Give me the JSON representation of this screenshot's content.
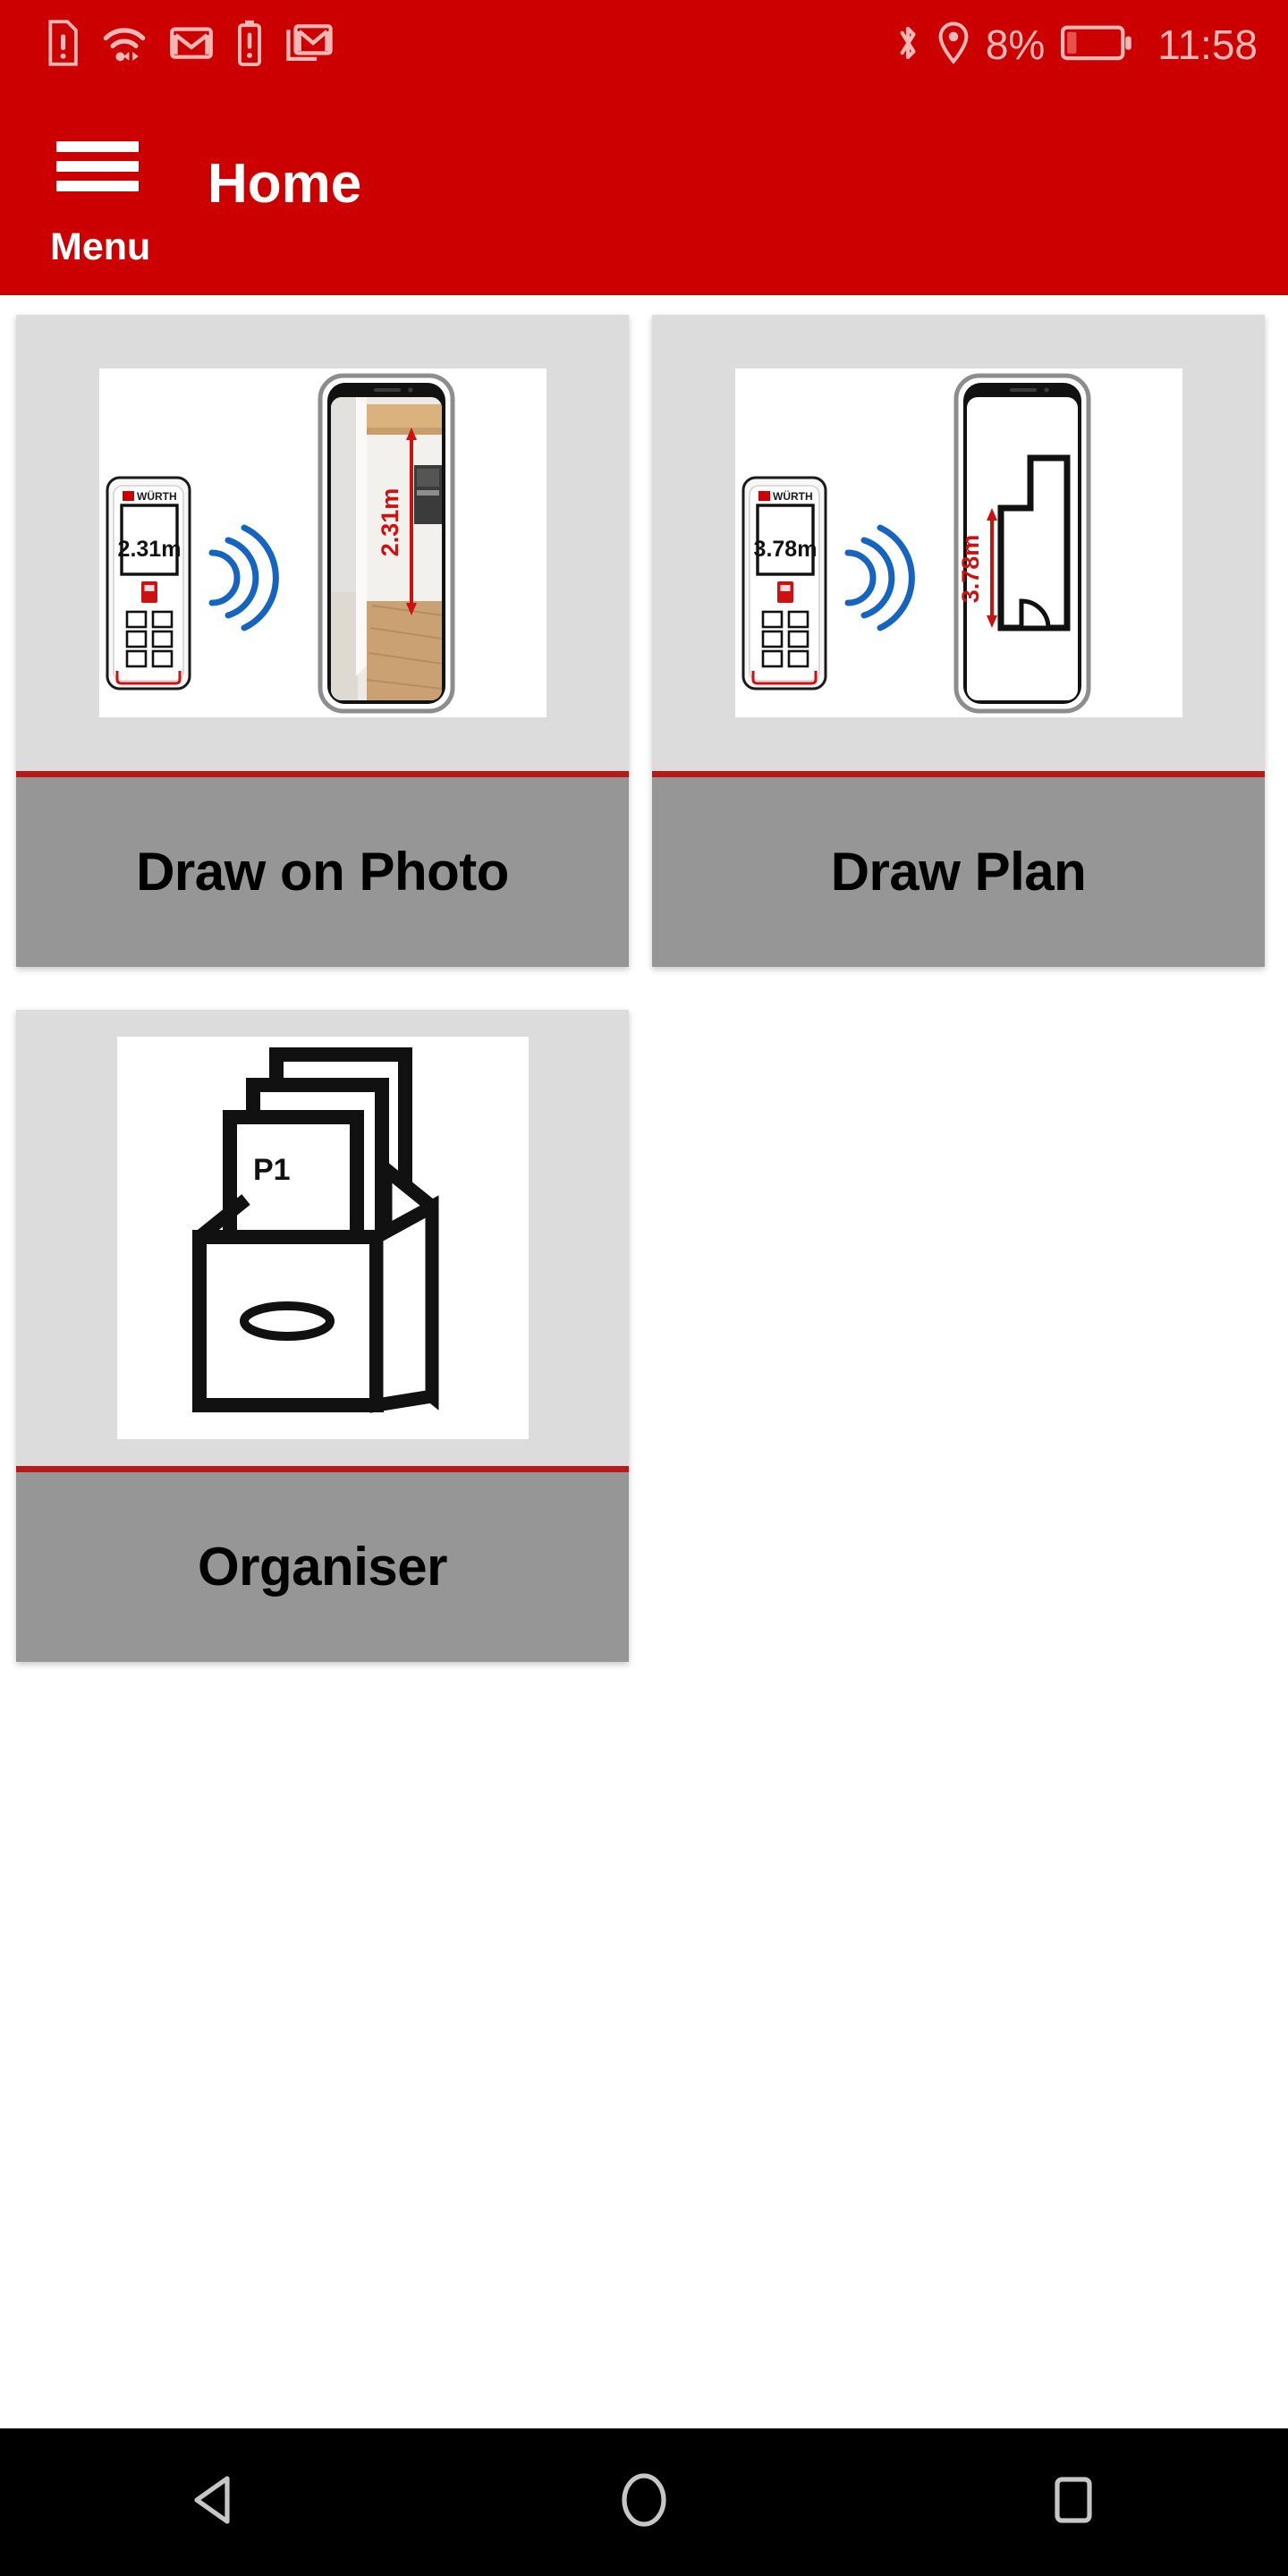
{
  "statusbar": {
    "left_icons": [
      {
        "name": "sim-card-alert-icon",
        "label": "SIM card alert"
      },
      {
        "name": "wifi-data-transfer-icon",
        "label": "WiFi with data transfer"
      },
      {
        "name": "gmail-icon",
        "label": "Gmail notification"
      },
      {
        "name": "battery-alert-icon",
        "label": "Battery alert"
      },
      {
        "name": "gmail-stacked-icon",
        "label": "Gmail multiple notifications"
      }
    ],
    "bluetooth_icon": "bluetooth-icon",
    "location_icon": "location-pin-icon",
    "battery_percent": "8%",
    "battery_icon": "battery-low-icon",
    "battery_level": 8,
    "clock": "11:58",
    "background_color": "#cc0000",
    "icon_color": "#f3b9b6"
  },
  "appbar": {
    "menu_icon": "hamburger-menu-icon",
    "menu_label": "Menu",
    "title": "Home",
    "background_color": "#cc0000",
    "text_color": "#ffffff"
  },
  "home": {
    "cards": [
      {
        "id": "draw-on-photo",
        "label": "Draw on Photo",
        "thumbnail": {
          "type": "laser-meter-to-phone-photo",
          "device_brand": "WÜRTH",
          "device_reading": "2.31m",
          "phone_annotation": "2.31m",
          "phone_content": "room-photo",
          "signal_icon": "wireless-signal-icon"
        }
      },
      {
        "id": "draw-plan",
        "label": "Draw Plan",
        "thumbnail": {
          "type": "laser-meter-to-phone-plan",
          "device_brand": "WÜRTH",
          "device_reading": "3.78m",
          "phone_annotation": "3.78m",
          "phone_content": "floor-plan-outline",
          "signal_icon": "wireless-signal-icon"
        }
      },
      {
        "id": "organiser",
        "label": "Organiser",
        "thumbnail": {
          "type": "file-box-with-documents",
          "document_label": "P1"
        }
      }
    ],
    "card_background_color": "#dcdcdc",
    "label_background_color": "#969696",
    "separator_color": "#b61b1b"
  },
  "navbar": {
    "background_color": "#000000",
    "buttons": [
      {
        "name": "back-button",
        "icon": "back-triangle-icon"
      },
      {
        "name": "home-button",
        "icon": "home-circle-icon"
      },
      {
        "name": "recents-button",
        "icon": "recents-square-icon"
      }
    ]
  }
}
